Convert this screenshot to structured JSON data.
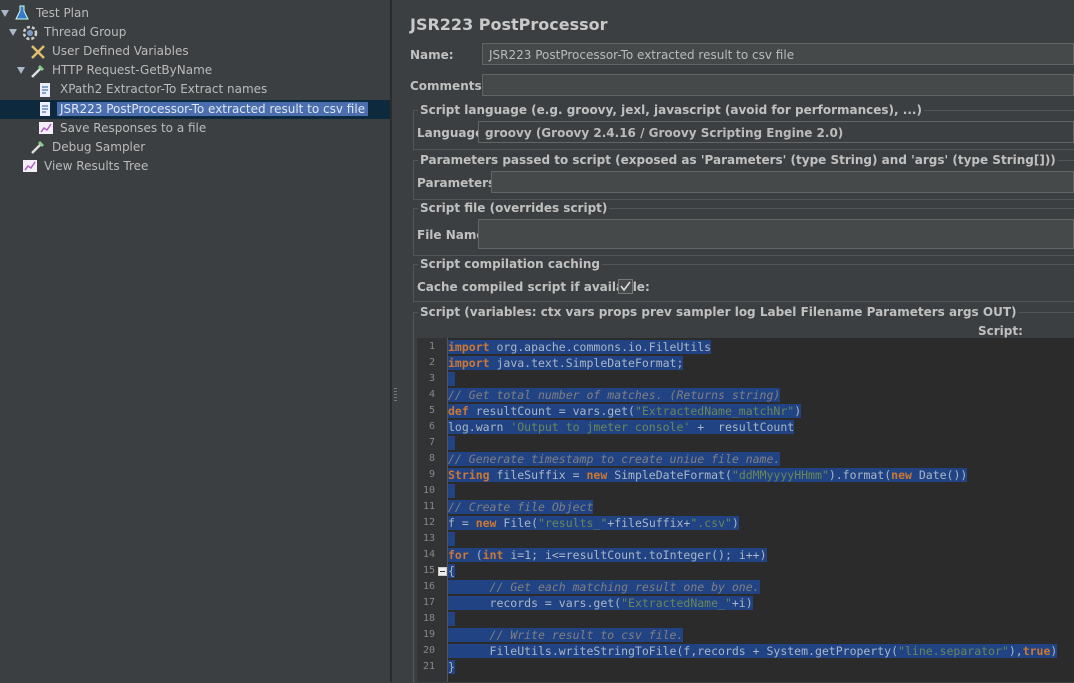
{
  "tree": {
    "items": [
      {
        "label": "Test Plan",
        "icon": "flask-icon"
      },
      {
        "label": "Thread Group",
        "icon": "gear-icon"
      },
      {
        "label": "User Defined Variables",
        "icon": "tools-icon"
      },
      {
        "label": "HTTP Request-GetByName",
        "icon": "pipette-icon"
      },
      {
        "label": "XPath2 Extractor-To Extract names",
        "icon": "script-icon"
      },
      {
        "label": "JSR223 PostProcessor-To extracted result to csv file",
        "icon": "script-icon"
      },
      {
        "label": "Save Responses to a file",
        "icon": "graph-icon"
      },
      {
        "label": "Debug Sampler",
        "icon": "pipette-icon"
      },
      {
        "label": "View Results Tree",
        "icon": "graph-icon"
      }
    ]
  },
  "panel": {
    "title": "JSR223 PostProcessor",
    "name_label": "Name:",
    "name_value": "JSR223 PostProcessor-To extracted result to csv file",
    "comments_label": "Comments:",
    "comments_value": "",
    "lang_group": "Script language (e.g. groovy, jexl, javascript (avoid for performances), ...)",
    "lang_label": "Language:",
    "lang_value": "groovy     (Groovy 2.4.16 / Groovy Scripting Engine 2.0)",
    "params_group": "Parameters passed to script (exposed as 'Parameters' (type String) and 'args' (type String[]))",
    "params_label": "Parameters:",
    "params_value": "",
    "file_group": "Script file (overrides script)",
    "file_label": "File Name:",
    "file_value": "",
    "cache_group": "Script compilation caching",
    "cache_label": "Cache compiled script if available:",
    "cache_checked": true,
    "script_group": "Script (variables: ctx vars props prev sampler log Label Filename Parameters args OUT)",
    "script_label": "Script:"
  },
  "code": {
    "line_numbers": [
      "1",
      "2",
      "3",
      "4",
      "5",
      "6",
      "7",
      "8",
      "9",
      "10",
      "11",
      "12",
      "13",
      "14",
      "15",
      "16",
      "17",
      "18",
      "19",
      "20",
      "21"
    ],
    "lines": [
      "import org.apache.commons.io.FileUtils",
      "import java.text.SimpleDateFormat;",
      "",
      "// Get total number of matches. (Returns string)",
      "def resultCount = vars.get(\"ExtractedName_matchNr\")",
      "log.warn 'Output to jmeter console' +  resultCount",
      "",
      "// Generate timestamp to create uniue file name.",
      "String fileSuffix = new SimpleDateFormat(\"ddMMyyyyHHmm\").format(new Date())",
      "",
      "// Create file Object",
      "f = new File(\"results_\"+fileSuffix+\".csv\")",
      "",
      "for (int i=1; i<=resultCount.toInteger(); i++)",
      "{",
      "      // Get each matching result one by one.",
      "      records = vars.get(\"ExtractedName_\"+i)",
      "",
      "      // Write result to csv file.",
      "      FileUtils.writeStringToFile(f,records + System.getProperty(\"line.separator\"),true)",
      "}"
    ]
  }
}
